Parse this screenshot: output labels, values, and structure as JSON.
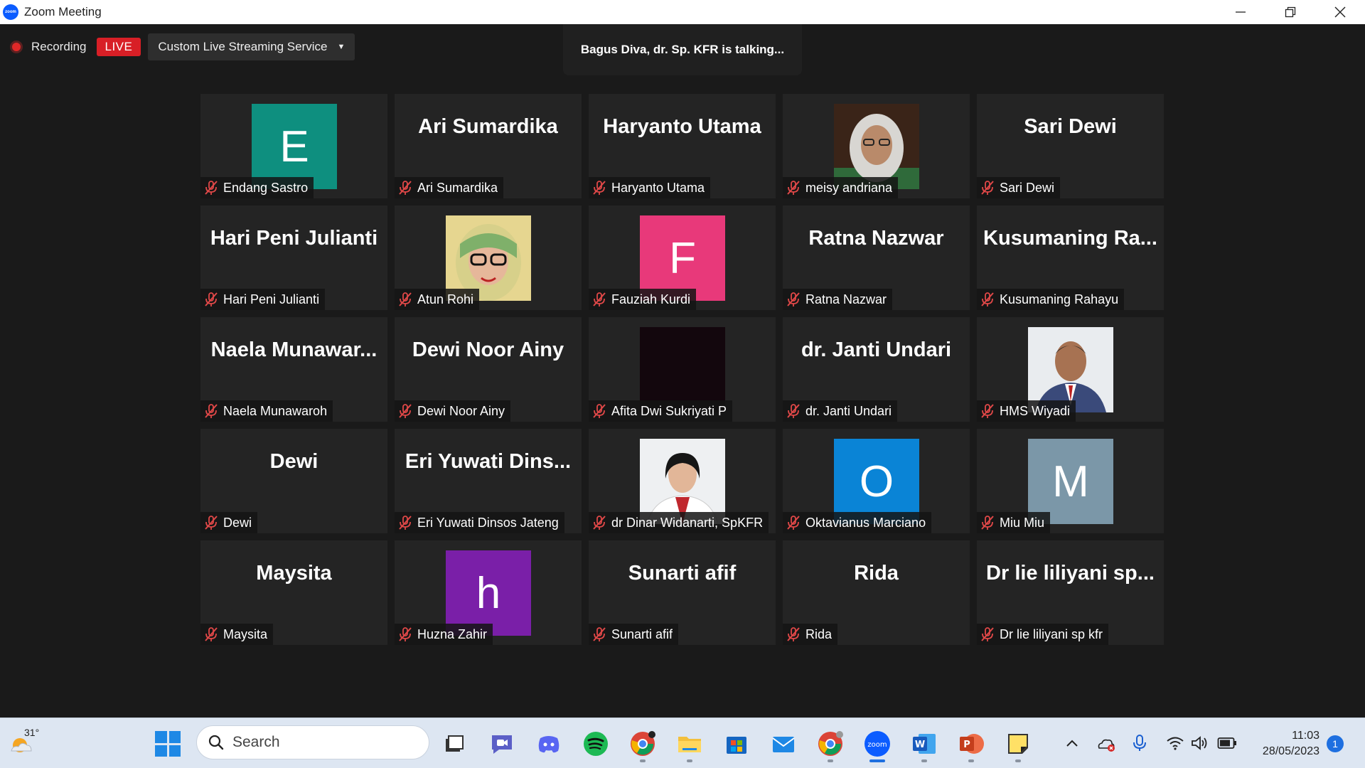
{
  "window": {
    "title": "Zoom Meeting"
  },
  "recording": {
    "label": "Recording",
    "live_badge": "LIVE",
    "stream_service": "Custom Live Streaming Service"
  },
  "talking": {
    "text": "Bagus Diva, dr. Sp. KFR is talking..."
  },
  "participants": [
    {
      "name": "Endang Sastro",
      "big": "",
      "avatar_letter": "E",
      "avatar_color": "#0e8f7f"
    },
    {
      "name": "Ari Sumardika",
      "big": "Ari Sumardika"
    },
    {
      "name": "Haryanto Utama",
      "big": "Haryanto Utama"
    },
    {
      "name": "meisy andriana",
      "big": "",
      "photo": "photo-hijab-woman"
    },
    {
      "name": "Sari Dewi",
      "big": "Sari Dewi"
    },
    {
      "name": "Hari Peni Julianti",
      "big": "Hari Peni Julianti"
    },
    {
      "name": "Atun Rohi",
      "big": "",
      "photo": "photo-woman-glasses"
    },
    {
      "name": "Fauziah Kurdi",
      "big": "",
      "avatar_letter": "F",
      "avatar_color": "#e8397a"
    },
    {
      "name": "Ratna Nazwar",
      "big": "Ratna Nazwar"
    },
    {
      "name": "Kusumaning Rahayu",
      "big": "Kusumaning  Ra..."
    },
    {
      "name": "Naela Munawaroh",
      "big": "Naela  Munawar..."
    },
    {
      "name": "Dewi Noor Ainy",
      "big": "Dewi Noor Ainy"
    },
    {
      "name": "Afita Dwi Sukriyati P",
      "big": "",
      "photo": "photo-dark"
    },
    {
      "name": "dr. Janti Undari",
      "big": "dr. Janti Undari"
    },
    {
      "name": "HMS Wiyadi",
      "big": "",
      "photo": "photo-man-suit"
    },
    {
      "name": "Dewi",
      "big": "Dewi"
    },
    {
      "name": "Eri Yuwati Dinsos Jateng",
      "big": "Eri  Yuwati  Dins..."
    },
    {
      "name": "dr Dinar Widanarti, SpKFR",
      "big": "",
      "photo": "photo-woman-doctor"
    },
    {
      "name": "Oktavianus Marciano",
      "big": "",
      "avatar_letter": "O",
      "avatar_color": "#0a84d6"
    },
    {
      "name": "Miu Miu",
      "big": "",
      "avatar_letter": "M",
      "avatar_color": "#7b97a8"
    },
    {
      "name": "Maysita",
      "big": "Maysita"
    },
    {
      "name": "Huzna Zahir",
      "big": "",
      "avatar_letter": "h",
      "avatar_color": "#7a1fa8"
    },
    {
      "name": "Sunarti afif",
      "big": "Sunarti afif"
    },
    {
      "name": "Rida",
      "big": "Rida"
    },
    {
      "name": "Dr lie liliyani sp kfr",
      "big": "Dr lie liliyani sp..."
    }
  ],
  "taskbar": {
    "weather_temp": "31°",
    "search_label": "Search",
    "clock_time": "11:03",
    "clock_date": "28/05/2023",
    "notification_count": "1",
    "apps": [
      "task-view-icon",
      "teams-chat-icon",
      "discord-icon",
      "spotify-icon",
      "chrome-icon",
      "file-explorer-icon",
      "microsoft-store-icon",
      "mail-icon",
      "chrome-profile-icon",
      "zoom-icon",
      "word-icon",
      "powerpoint-icon",
      "sticky-notes-icon"
    ]
  },
  "colors": {
    "accent": "#0b5cff",
    "live": "#d81f26",
    "mic_muted": "#e04848",
    "tile_bg": "#242424"
  }
}
